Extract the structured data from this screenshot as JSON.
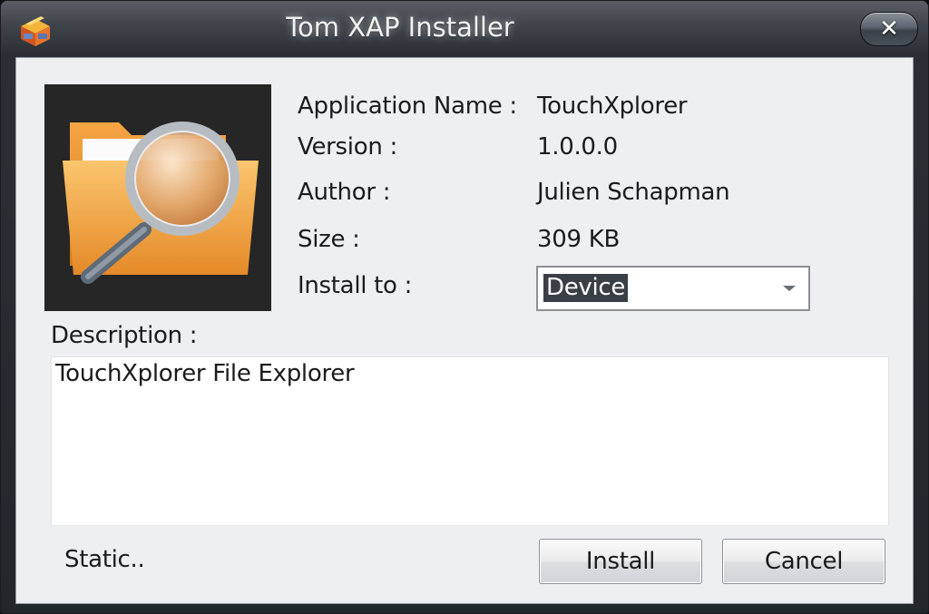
{
  "window": {
    "title": "Tom XAP Installer",
    "close_label": "✕"
  },
  "app_info": {
    "name_label": "Application Name :",
    "name_value": "TouchXplorer",
    "version_label": "Version :",
    "version_value": "1.0.0.0",
    "author_label": "Author :",
    "author_value": "Julien Schapman",
    "size_label": "Size :",
    "size_value": "309 KB",
    "install_to_label": "Install to :",
    "install_to_value": "Device"
  },
  "description": {
    "label": "Description :",
    "text": "TouchXplorer File Explorer"
  },
  "footer": {
    "status": "Static..",
    "install_label": "Install",
    "cancel_label": "Cancel"
  },
  "icons": {
    "window_icon": "package-box-icon",
    "app_icon": "folder-search-icon"
  }
}
